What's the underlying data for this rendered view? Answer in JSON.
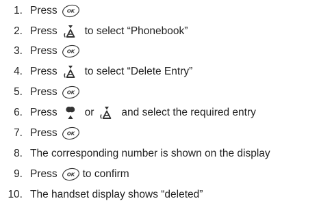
{
  "steps": [
    {
      "num": "1.",
      "press": "Press"
    },
    {
      "num": "2.",
      "press": "Press",
      "after": "to select “Phonebook”"
    },
    {
      "num": "3.",
      "press": "Press"
    },
    {
      "num": "4.",
      "press": "Press",
      "after": "to select “Delete Entry”"
    },
    {
      "num": "5.",
      "press": "Press"
    },
    {
      "num": "6.",
      "press": "Press",
      "mid": "or",
      "after": "and select the required entry"
    },
    {
      "num": "7.",
      "press": "Press"
    },
    {
      "num": "8.",
      "text": "The corresponding number is shown on the display"
    },
    {
      "num": "9.",
      "press": "Press",
      "after": "to confirm"
    },
    {
      "num": "10.",
      "text": "The handset display shows “deleted”"
    }
  ],
  "icons": {
    "ok_key_label": "OK",
    "ok_key": "ok-key-icon",
    "down_key": "down-phonebook-key-icon",
    "up_key": "up-key-icon"
  }
}
